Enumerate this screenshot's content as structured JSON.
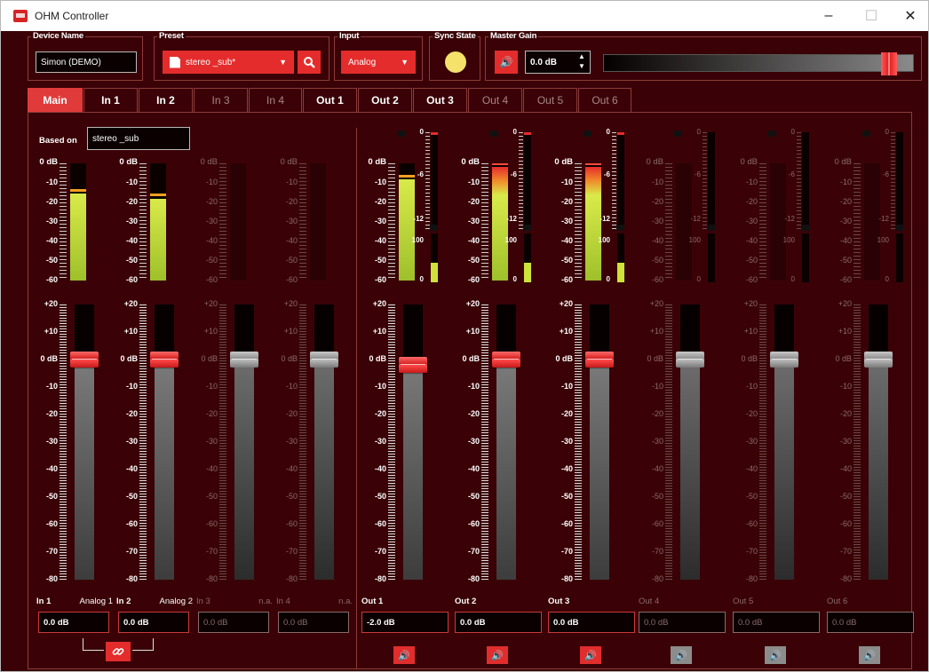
{
  "window": {
    "title": "OHM Controller",
    "minimize": "–",
    "maximize": "☐",
    "close": "✕"
  },
  "device_name": {
    "label": "Device Name",
    "value": "Simon (DEMO)"
  },
  "preset": {
    "label": "Preset",
    "value": "stereo _sub*",
    "search_icon": "search-icon"
  },
  "input": {
    "label": "Input",
    "value": "Analog"
  },
  "sync_state": {
    "label": "Sync State",
    "color": "#f5e26a"
  },
  "master_gain": {
    "label": "Master Gain",
    "value": "0.0 dB",
    "slider_level": 0.93
  },
  "tabs": [
    "Main",
    "In 1",
    "In 2",
    "In 3",
    "In 4",
    "Out 1",
    "Out 2",
    "Out 3",
    "Out 4",
    "Out 5",
    "Out 6"
  ],
  "based_on": {
    "label": "Based on",
    "value": "stereo _sub"
  },
  "meter_scale": [
    "0 dB",
    "-10",
    "-20",
    "-30",
    "-40",
    "-50",
    "-60"
  ],
  "fader_scale": [
    "+20",
    "+10",
    "0 dB",
    "-10",
    "-20",
    "-30",
    "-40",
    "-50",
    "-60",
    "-70",
    "-80"
  ],
  "limiter_scale": [
    "0",
    "-6",
    "-12",
    "100",
    "0"
  ],
  "inputs": [
    {
      "name": "In 1",
      "source": "Analog 1",
      "value": "0.0 dB",
      "active": true,
      "level": 0.74,
      "fader_db": 0
    },
    {
      "name": "In 2",
      "source": "Analog 2",
      "value": "0.0 dB",
      "active": true,
      "level": 0.7,
      "fader_db": 0
    },
    {
      "name": "In 3",
      "source": "n.a.",
      "value": "0.0 dB",
      "active": false,
      "level": 0,
      "fader_db": 0
    },
    {
      "name": "In 4",
      "source": "n.a.",
      "value": "0.0 dB",
      "active": false,
      "level": 0,
      "fader_db": 0
    }
  ],
  "outputs": [
    {
      "name": "Out 1",
      "value": "-2.0 dB",
      "active": true,
      "level": 0.86,
      "fader_db": -2
    },
    {
      "name": "Out 2",
      "value": "0.0 dB",
      "active": true,
      "level": 0.97,
      "fader_db": 0
    },
    {
      "name": "Out 3",
      "value": "0.0 dB",
      "active": true,
      "level": 0.97,
      "fader_db": 0
    },
    {
      "name": "Out 4",
      "value": "0.0 dB",
      "active": false,
      "level": 0,
      "fader_db": 0
    },
    {
      "name": "Out 5",
      "value": "0.0 dB",
      "active": false,
      "level": 0,
      "fader_db": 0
    },
    {
      "name": "Out 6",
      "value": "0.0 dB",
      "active": false,
      "level": 0,
      "fader_db": 0
    }
  ],
  "icons": {
    "mute": "speaker-icon",
    "link": "link-icon",
    "app": "app-icon",
    "preset_file": "file-icon",
    "dropdown": "chevron-down-icon",
    "spinner": "spinner-arrows-icon"
  },
  "colors": {
    "background": "#3a0206",
    "accent": "#e42c2c",
    "meter_green": "#c8de3a",
    "disabled": "#8a6a6a"
  }
}
